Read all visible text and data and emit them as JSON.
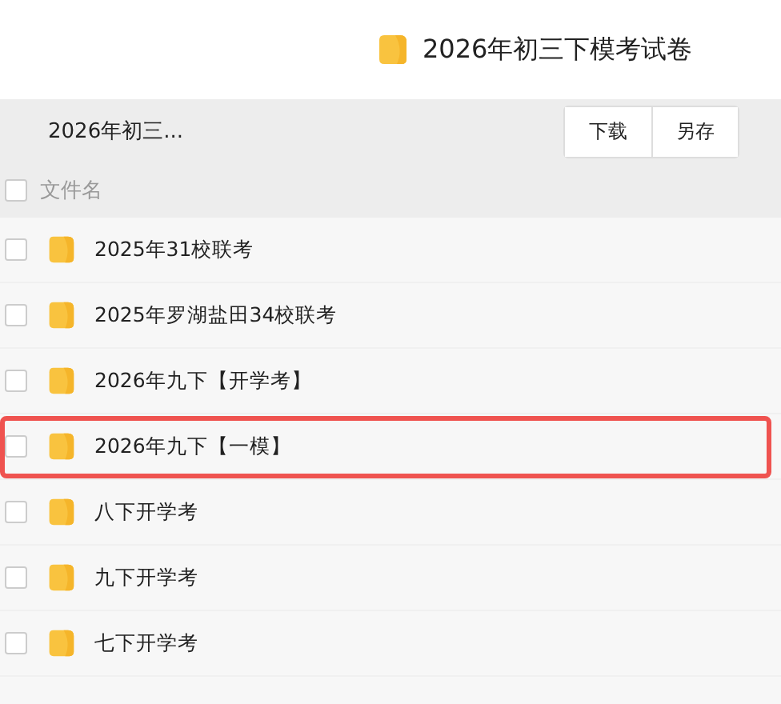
{
  "header": {
    "title": "2026年初三下模考试卷"
  },
  "toolbar": {
    "breadcrumb": "2026年初三...",
    "buttons": [
      "下载",
      "另存"
    ]
  },
  "table": {
    "column": "文件名",
    "header_checked": false,
    "rows": [
      {
        "name": "2025年31校联考",
        "checked": false,
        "highlighted": false
      },
      {
        "name": "2025年罗湖盐田34校联考",
        "checked": false,
        "highlighted": false
      },
      {
        "name": "2026年九下【开学考】",
        "checked": false,
        "highlighted": false
      },
      {
        "name": "2026年九下【一模】",
        "checked": false,
        "highlighted": true
      },
      {
        "name": "八下开学考",
        "checked": false,
        "highlighted": false
      },
      {
        "name": "九下开学考",
        "checked": false,
        "highlighted": false
      },
      {
        "name": "七下开学考",
        "checked": false,
        "highlighted": false
      }
    ]
  }
}
